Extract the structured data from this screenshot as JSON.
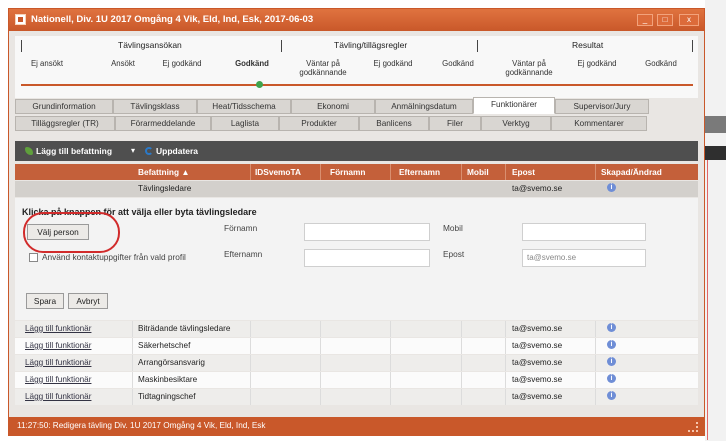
{
  "window": {
    "title": "Nationell, Div. 1U 2017 Omgång 4 Vik, Eld, Ind, Esk, 2017-06-03",
    "btn_min": "_",
    "btn_max": "□",
    "btn_close": "x"
  },
  "wizard": {
    "groups": [
      "Tävlingsansökan",
      "Tävling/tillägsregler",
      "Resultat"
    ],
    "steps": [
      {
        "label": "Ej ansökt",
        "active": false
      },
      {
        "label": "Ansökt",
        "active": false
      },
      {
        "label": "Ej godkänd",
        "active": false
      },
      {
        "label": "Godkänd",
        "active": true
      },
      {
        "label": "Väntar på\ngodkännande",
        "active": false
      },
      {
        "label": "Ej godkänd",
        "active": false
      },
      {
        "label": "Godkänd",
        "active": false
      },
      {
        "label": "Väntar på\ngodkännande",
        "active": false
      },
      {
        "label": "Ej godkänd",
        "active": false
      },
      {
        "label": "Godkänd",
        "active": false
      }
    ]
  },
  "tabs_row1": [
    "Grundinformation",
    "Tävlingsklass",
    "Heat/Tidsschema",
    "Ekonomi",
    "Anmälningsdatum",
    "Funktionärer",
    "Supervisor/Jury"
  ],
  "tabs_row2": [
    "Tilläggsregler (TR)",
    "Förarmeddelande",
    "Laglista",
    "Produkter",
    "Banlicens",
    "Filer",
    "Verktyg",
    "Kommentarer"
  ],
  "active_tab": "Funktionärer",
  "toolbar": {
    "add_label": "Lägg till befattning",
    "add_caret": "▾",
    "update_label": "Uppdatera"
  },
  "grid": {
    "columns": [
      "Befattning ▲",
      "IDSvemoTA",
      "Förnamn",
      "Efternamn",
      "Mobil",
      "Epost",
      "Skapad/Ändrad"
    ],
    "selected_row": {
      "position": "Tävlingsledare",
      "email": "ta@svemo.se",
      "info": "i"
    },
    "rows": [
      {
        "action": "Lägg till funktionär",
        "position": "Biträdande tävlingsledare",
        "email": "ta@svemo.se",
        "info": "i"
      },
      {
        "action": "Lägg till funktionär",
        "position": "Säkerhetschef",
        "email": "ta@svemo.se",
        "info": "i"
      },
      {
        "action": "Lägg till funktionär",
        "position": "Arrangörsansvarig",
        "email": "ta@svemo.se",
        "info": "i"
      },
      {
        "action": "Lägg till funktionär",
        "position": "Maskinbesiktare",
        "email": "ta@svemo.se",
        "info": "i"
      },
      {
        "action": "Lägg till funktionär",
        "position": "Tidtagningschef",
        "email": "ta@svemo.se",
        "info": "i"
      }
    ]
  },
  "detail": {
    "heading": "Klicka på knappen för att välja eller byta tävlingsledare",
    "choose_button": "Välj person",
    "checkbox_label": "Använd kontaktuppgifter från vald profil",
    "firstname_label": "Förnamn",
    "lastname_label": "Efternamn",
    "mobile_label": "Mobil",
    "email_label": "Epost",
    "firstname_value": "",
    "lastname_value": "",
    "mobile_value": "",
    "email_placeholder": "ta@svemo.se",
    "save_button": "Spara",
    "cancel_button": "Avbryt"
  },
  "status": {
    "text": "11:27:50: Redigera tävling Div. 1U 2017 Omgång 4 Vik, Eld, Ind, Esk"
  },
  "colors": {
    "accent": "#c9582a",
    "grid_header": "#c4603a",
    "toolbar": "#4f4f4f",
    "highlight_ring": "#d12b2b",
    "wizard_dot": "#3fa34d"
  }
}
